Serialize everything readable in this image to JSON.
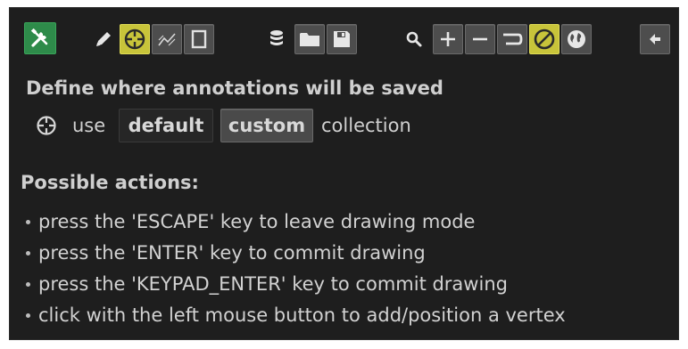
{
  "toolbar": {
    "buttons": [
      {
        "icon": "tools-icon",
        "state": "green"
      },
      {
        "icon": "pencil-icon",
        "state": "flat"
      },
      {
        "icon": "crosshair-icon",
        "state": "active"
      },
      {
        "icon": "polyline-icon",
        "state": "normal"
      },
      {
        "icon": "rectangle-icon",
        "state": "normal"
      },
      {
        "icon": "database-icon",
        "state": "flat"
      },
      {
        "icon": "folder-icon",
        "state": "normal"
      },
      {
        "icon": "save-icon",
        "state": "normal"
      },
      {
        "icon": "search-icon",
        "state": "flat"
      },
      {
        "icon": "plus-icon",
        "state": "normal"
      },
      {
        "icon": "minus-icon",
        "state": "normal"
      },
      {
        "icon": "undo-icon",
        "state": "normal"
      },
      {
        "icon": "cancel-icon",
        "state": "active"
      },
      {
        "icon": "globe-icon",
        "state": "normal"
      },
      {
        "icon": "arrow-left-icon",
        "state": "normal"
      }
    ],
    "accent_color": "#c8c43a",
    "home_color": "#2e8b4a"
  },
  "collection": {
    "heading": "Define where annotations will be saved",
    "prefix": "use",
    "options": [
      "default",
      "custom"
    ],
    "selected": "custom",
    "suffix": "collection"
  },
  "actions": {
    "title": "Possible actions:",
    "items": [
      "press the 'ESCAPE' key to leave drawing mode",
      "press the 'ENTER' key to commit drawing",
      "press the 'KEYPAD_ENTER' key to commit drawing",
      "click with the left mouse button to add/position a vertex"
    ]
  }
}
